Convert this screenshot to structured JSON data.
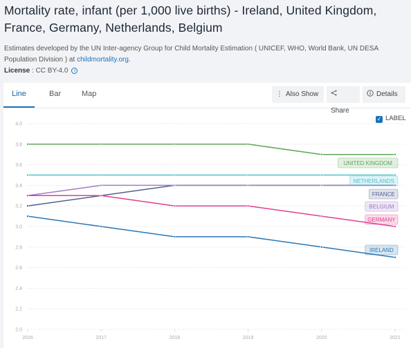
{
  "header": {
    "title": "Mortality rate, infant (per 1,000 live births) - Ireland, United Kingdom, France, Germany, Netherlands, Belgium",
    "description": "Estimates developed by the UN Inter-agency Group for Child Mortality Estimation ( UNICEF, WHO, World Bank, UN DESA Population Division ) at ",
    "source_link": "childmortality.org",
    "description_end": ".",
    "license_label": "License",
    "license_value": " : CC BY-4.0"
  },
  "tabs": [
    {
      "label": "Line",
      "active": true
    },
    {
      "label": "Bar",
      "active": false
    },
    {
      "label": "Map",
      "active": false
    }
  ],
  "toolbar": {
    "also_show": "Also Show",
    "share": "Share",
    "details": "Details",
    "label_toggle": "LABEL",
    "label_checked": true
  },
  "chart_data": {
    "type": "line",
    "title": "Mortality rate, infant (per 1,000 live births)",
    "xlabel": "",
    "ylabel": "",
    "x": [
      "2016",
      "2017",
      "2018",
      "2019",
      "2020",
      "2021"
    ],
    "ylim": [
      2.0,
      4.0
    ],
    "yticks": [
      "2.0",
      "2.2",
      "2.4",
      "2.6",
      "2.8",
      "3.0",
      "3.2",
      "3.4",
      "3.6",
      "3.8",
      "4.0"
    ],
    "grid": true,
    "legend": "inline-labels-right",
    "series": [
      {
        "name": "UNITED KINGDOM",
        "color": "#5ea558",
        "values": [
          3.8,
          3.8,
          3.8,
          3.8,
          3.7,
          3.7
        ]
      },
      {
        "name": "NETHERLANDS",
        "color": "#4cc1cc",
        "values": [
          3.5,
          3.5,
          3.5,
          3.5,
          3.5,
          3.5
        ]
      },
      {
        "name": "FRANCE",
        "color": "#525f94",
        "values": [
          3.2,
          3.3,
          3.4,
          3.4,
          3.4,
          3.4
        ]
      },
      {
        "name": "BELGIUM",
        "color": "#a07bc4",
        "values": [
          3.3,
          3.4,
          3.4,
          3.4,
          3.4,
          3.4
        ]
      },
      {
        "name": "GERMANY",
        "color": "#e03e8c",
        "values": [
          3.3,
          3.3,
          3.2,
          3.2,
          3.1,
          3.0
        ]
      },
      {
        "name": "IRELAND",
        "color": "#2a76b5",
        "values": [
          3.1,
          3.0,
          2.9,
          2.9,
          2.8,
          2.7
        ]
      }
    ]
  }
}
